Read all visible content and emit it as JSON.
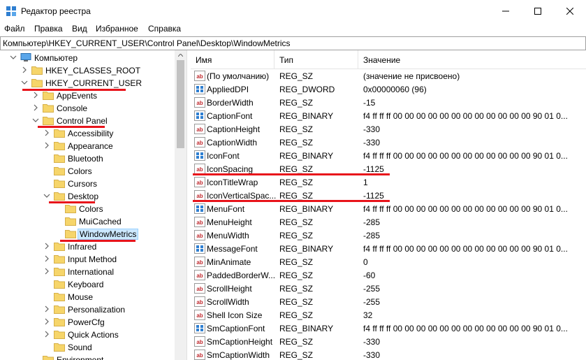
{
  "window": {
    "title": "Редактор реестра"
  },
  "menu": [
    "Файл",
    "Правка",
    "Вид",
    "Избранное",
    "Справка"
  ],
  "address": "Компьютер\\HKEY_CURRENT_USER\\Control Panel\\Desktop\\WindowMetrics",
  "tree": [
    {
      "label": "Компьютер",
      "depth": 0,
      "exp": "open",
      "icon": "computer"
    },
    {
      "label": "HKEY_CLASSES_ROOT",
      "depth": 1,
      "exp": "closed"
    },
    {
      "label": "HKEY_CURRENT_USER",
      "depth": 1,
      "exp": "open"
    },
    {
      "label": "AppEvents",
      "depth": 2,
      "exp": "closed"
    },
    {
      "label": "Console",
      "depth": 2,
      "exp": "closed"
    },
    {
      "label": "Control Panel",
      "depth": 2,
      "exp": "open"
    },
    {
      "label": "Accessibility",
      "depth": 3,
      "exp": "closed"
    },
    {
      "label": "Appearance",
      "depth": 3,
      "exp": "closed"
    },
    {
      "label": "Bluetooth",
      "depth": 3,
      "exp": "none"
    },
    {
      "label": "Colors",
      "depth": 3,
      "exp": "none"
    },
    {
      "label": "Cursors",
      "depth": 3,
      "exp": "none"
    },
    {
      "label": "Desktop",
      "depth": 3,
      "exp": "open"
    },
    {
      "label": "Colors",
      "depth": 4,
      "exp": "none"
    },
    {
      "label": "MuiCached",
      "depth": 4,
      "exp": "none"
    },
    {
      "label": "WindowMetrics",
      "depth": 4,
      "exp": "none",
      "selected": true
    },
    {
      "label": "Infrared",
      "depth": 3,
      "exp": "closed"
    },
    {
      "label": "Input Method",
      "depth": 3,
      "exp": "closed"
    },
    {
      "label": "International",
      "depth": 3,
      "exp": "closed"
    },
    {
      "label": "Keyboard",
      "depth": 3,
      "exp": "none"
    },
    {
      "label": "Mouse",
      "depth": 3,
      "exp": "none"
    },
    {
      "label": "Personalization",
      "depth": 3,
      "exp": "closed"
    },
    {
      "label": "PowerCfg",
      "depth": 3,
      "exp": "closed"
    },
    {
      "label": "Quick Actions",
      "depth": 3,
      "exp": "closed"
    },
    {
      "label": "Sound",
      "depth": 3,
      "exp": "none"
    },
    {
      "label": "Environment",
      "depth": 2,
      "exp": "none"
    }
  ],
  "columns": {
    "name": "Имя",
    "type": "Тип",
    "value": "Значение"
  },
  "values": [
    {
      "name": "(По умолчанию)",
      "type": "REG_SZ",
      "value": "(значение не присвоено)",
      "kind": "sz"
    },
    {
      "name": "AppliedDPI",
      "type": "REG_DWORD",
      "value": "0x00000060 (96)",
      "kind": "bin"
    },
    {
      "name": "BorderWidth",
      "type": "REG_SZ",
      "value": "-15",
      "kind": "sz"
    },
    {
      "name": "CaptionFont",
      "type": "REG_BINARY",
      "value": "f4 ff ff ff 00 00 00 00 00 00 00 00 00 00 00 00 90 01 0...",
      "kind": "bin"
    },
    {
      "name": "CaptionHeight",
      "type": "REG_SZ",
      "value": "-330",
      "kind": "sz"
    },
    {
      "name": "CaptionWidth",
      "type": "REG_SZ",
      "value": "-330",
      "kind": "sz"
    },
    {
      "name": "IconFont",
      "type": "REG_BINARY",
      "value": "f4 ff ff ff 00 00 00 00 00 00 00 00 00 00 00 00 90 01 0...",
      "kind": "bin"
    },
    {
      "name": "IconSpacing",
      "type": "REG_SZ",
      "value": "-1125",
      "kind": "sz"
    },
    {
      "name": "IconTitleWrap",
      "type": "REG_SZ",
      "value": "1",
      "kind": "sz"
    },
    {
      "name": "IconVerticalSpac...",
      "type": "REG_SZ",
      "value": "-1125",
      "kind": "sz"
    },
    {
      "name": "MenuFont",
      "type": "REG_BINARY",
      "value": "f4 ff ff ff 00 00 00 00 00 00 00 00 00 00 00 00 90 01 0...",
      "kind": "bin"
    },
    {
      "name": "MenuHeight",
      "type": "REG_SZ",
      "value": "-285",
      "kind": "sz"
    },
    {
      "name": "MenuWidth",
      "type": "REG_SZ",
      "value": "-285",
      "kind": "sz"
    },
    {
      "name": "MessageFont",
      "type": "REG_BINARY",
      "value": "f4 ff ff ff 00 00 00 00 00 00 00 00 00 00 00 00 90 01 0...",
      "kind": "bin"
    },
    {
      "name": "MinAnimate",
      "type": "REG_SZ",
      "value": "0",
      "kind": "sz"
    },
    {
      "name": "PaddedBorderW...",
      "type": "REG_SZ",
      "value": "-60",
      "kind": "sz"
    },
    {
      "name": "ScrollHeight",
      "type": "REG_SZ",
      "value": "-255",
      "kind": "sz"
    },
    {
      "name": "ScrollWidth",
      "type": "REG_SZ",
      "value": "-255",
      "kind": "sz"
    },
    {
      "name": "Shell Icon Size",
      "type": "REG_SZ",
      "value": "32",
      "kind": "sz"
    },
    {
      "name": "SmCaptionFont",
      "type": "REG_BINARY",
      "value": "f4 ff ff ff 00 00 00 00 00 00 00 00 00 00 00 00 90 01 0...",
      "kind": "bin"
    },
    {
      "name": "SmCaptionHeight",
      "type": "REG_SZ",
      "value": "-330",
      "kind": "sz"
    },
    {
      "name": "SmCaptionWidth",
      "type": "REG_SZ",
      "value": "-330",
      "kind": "sz"
    }
  ],
  "highlight_color": "#e8141b",
  "folder_color": "#f6d56a"
}
